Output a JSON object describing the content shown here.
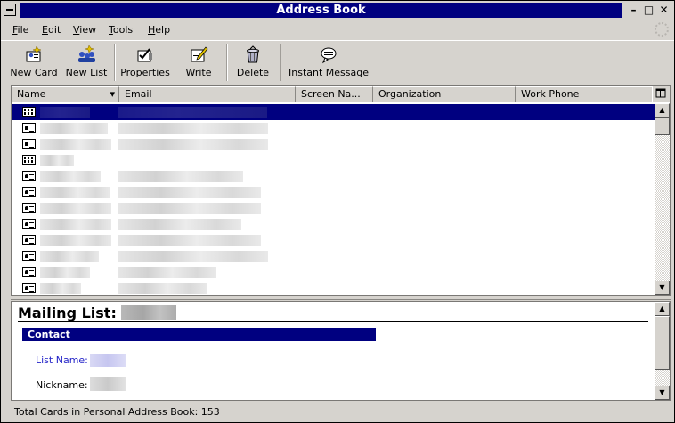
{
  "window": {
    "title": "Address Book",
    "buttons": {
      "minimize": "–",
      "maximize": "□",
      "close": "✕"
    }
  },
  "menu": [
    {
      "label": "File",
      "accel": "F",
      "rest": "ile"
    },
    {
      "label": "Edit",
      "accel": "E",
      "rest": "dit"
    },
    {
      "label": "View",
      "accel": "V",
      "rest": "iew"
    },
    {
      "label": "Tools",
      "accel": "T",
      "rest": "ools"
    },
    {
      "label": "Help",
      "accel": "H",
      "rest": "elp"
    }
  ],
  "toolbar": {
    "new_card": "New Card",
    "new_list": "New List",
    "properties": "Properties",
    "write": "Write",
    "delete": "Delete",
    "instant_message": "Instant Message"
  },
  "columns": [
    "Name",
    "Email",
    "Screen Na...",
    "Organization",
    "Work Phone"
  ],
  "sort_indicator": "▾",
  "scroll": {
    "up": "▲",
    "down": "▼"
  },
  "detail": {
    "heading": "Mailing List:",
    "section": "Contact",
    "list_name_label": "List Name:",
    "nickname_label": "Nickname:"
  },
  "status": {
    "text": "Total Cards in Personal Address Book: 153"
  },
  "colors": {
    "title_bar": "#000080",
    "selection": "#000080",
    "link_label": "#2424c8",
    "chrome": "#d6d3ce"
  }
}
